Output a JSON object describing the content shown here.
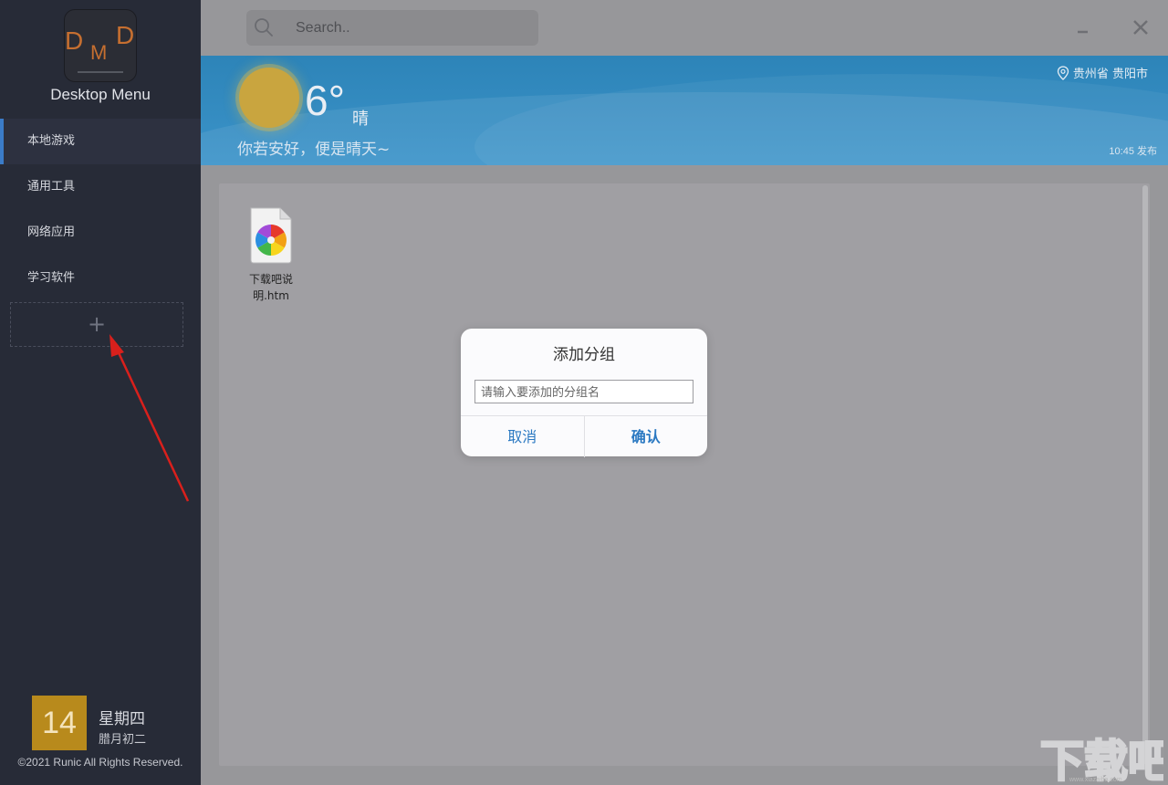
{
  "app": {
    "logo_letters": [
      "D",
      "M",
      "D"
    ],
    "name": "Desktop Menu"
  },
  "sidebar": {
    "items": [
      {
        "label": "本地游戏",
        "active": true
      },
      {
        "label": "通用工具",
        "active": false
      },
      {
        "label": "网络应用",
        "active": false
      },
      {
        "label": "学习软件",
        "active": false
      }
    ],
    "add_label": "+",
    "date": {
      "day": "14",
      "weekday": "星期四",
      "lunar": "腊月初二"
    },
    "copyright": "©2021 Runic All Rights Reserved."
  },
  "search": {
    "placeholder": "Search.."
  },
  "window": {
    "minimize_label": "−",
    "close_label": "×"
  },
  "weather": {
    "temperature": "6°",
    "condition": "晴",
    "tagline": "你若安好，便是晴天~",
    "location": "贵州省 贵阳市",
    "published": "10:45 发布"
  },
  "files": [
    {
      "name": "下载吧说明.htm",
      "icon": "htm-file-icon"
    }
  ],
  "dialog": {
    "title": "添加分组",
    "placeholder": "请输入要添加的分组名",
    "cancel_label": "取消",
    "confirm_label": "确认"
  },
  "colors": {
    "sidebar_bg": "#272b37",
    "accent": "#3b7cc8",
    "weather_bg": "#2d84b8",
    "date_box": "#b88a1c",
    "dialog_button": "#2b79c2",
    "annotation_arrow": "#d9201c"
  },
  "watermark": {
    "text": "下载吧",
    "url": "www.xiazaiba.com"
  }
}
